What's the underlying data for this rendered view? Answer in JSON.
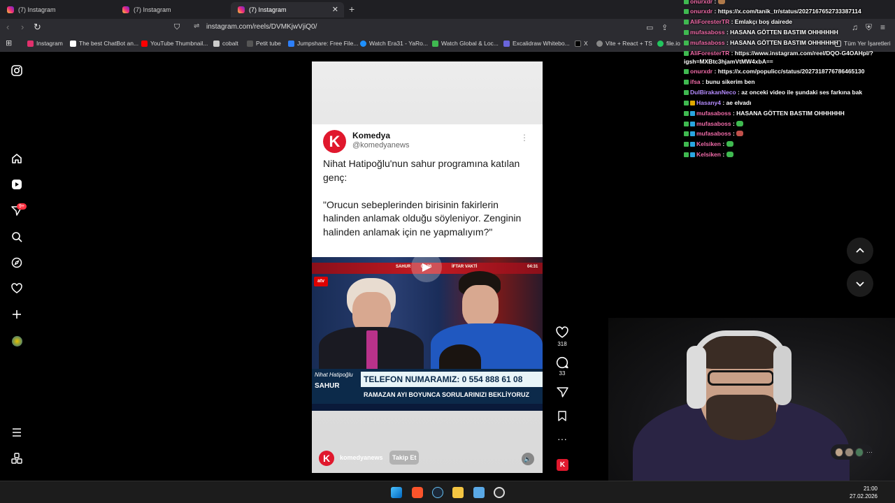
{
  "tabs": [
    {
      "title": "(7) Instagram"
    },
    {
      "title": "(7) Instagram"
    },
    {
      "title": "(7) Instagram"
    }
  ],
  "address": {
    "url": "instagram.com/reels/DVMKjwVjiQ0/"
  },
  "bookmarks": [
    {
      "label": "Instagram",
      "color": "#e1306c"
    },
    {
      "label": "The best ChatBot an...",
      "color": "#ffffff"
    },
    {
      "label": "YouTube Thumbnail...",
      "color": "#ff0000"
    },
    {
      "label": "cobalt",
      "color": "#cccccc"
    },
    {
      "label": "Petit tube",
      "color": "#333333"
    },
    {
      "label": "Jumpshare: Free File...",
      "color": "#2d7ff9"
    },
    {
      "label": "Watch Era31 - YaRo...",
      "color": "#1e90ff"
    },
    {
      "label": "Watch Global & Loc...",
      "color": "#3fb950"
    },
    {
      "label": "Excalidraw Whitebo...",
      "color": "#6965db"
    },
    {
      "label": "X",
      "color": "#000000"
    },
    {
      "label": "Vite + React + TS",
      "color": "#888888"
    },
    {
      "label": "file.io",
      "color": "#22c55e"
    }
  ],
  "bookmarks_all": "Tüm Yer İşaretleri",
  "reel": {
    "tweet_name": "Komedya",
    "tweet_handle": "@komedyanews",
    "tweet_text": "Nihat Hatipoğlu'nun sahur programına katılan genç:\n\n\"Orucun sebeplerinden birisinin fakirlerin halinden anlamak olduğu söyleniyor. Zenginin halinden anlamak için ne yapmalıyım?\"",
    "logo_letter": "K",
    "tv_channel": "atv",
    "band_left": "SAHUR",
    "band_mid": "05:26",
    "band_right": "İFTAR VAKTİ",
    "band_time": "04:31",
    "lower_small": "Nihat Hatipoğlu",
    "lower_big": "SAHUR",
    "phone_line": "TELEFON NUMARAMIZ: 0 554 888 61 08",
    "ramazan_line": "RAMAZAN AYI BOYUNCA SORULARINIZI BEKLİYORUZ",
    "footer_user": "komedyanews",
    "follow_label": "Takip Et",
    "likes": "318",
    "comments": "33"
  },
  "notifications_badge": "9+",
  "chat": [
    {
      "user": "onurxdr",
      "color": "#f06ba8",
      "msg": ""
    },
    {
      "user": "onurxdr",
      "color": "#f06ba8",
      "msg": "https://x.com/tanik_tr/status/2027167652733387114"
    },
    {
      "user": "AliForesterTR",
      "color": "#f06ba8",
      "msg": "Emlakçı boş dairede"
    },
    {
      "user": "mufasaboss",
      "color": "#f06ba8",
      "msg": "HASANA GÖTTEN BASTIM OHHHHHH"
    },
    {
      "user": "mufasaboss",
      "color": "#f06ba8",
      "msg": "HASANA GÖTTEN BASTIM OHHHHHH"
    },
    {
      "user": "AliForesterTR",
      "color": "#f06ba8",
      "msg": "https://www.instagram.com/reel/DQO-G4OAHpl/?"
    },
    {
      "user": "",
      "color": "#ffffff",
      "msg": "igsh=MXBtc3hjamVtMW4xbA=="
    },
    {
      "user": "onurxdr",
      "color": "#f06ba8",
      "msg": "https://x.com/populicc/status/2027318776786465130"
    },
    {
      "user": "ifsa",
      "color": "#f06ba8",
      "msg": "bunu sikerim ben"
    },
    {
      "user": "DulBirakanNeco",
      "color": "#b58cff",
      "msg": "az onceki video ile şundaki ses farkına bak"
    },
    {
      "user": "Hasany4",
      "color": "#b58cff",
      "msg": "ae elvadı"
    },
    {
      "user": "mufasaboss",
      "color": "#f06ba8",
      "msg": "HASANA GÖTTEN BASTIM OHHHHHH"
    },
    {
      "user": "mufasaboss",
      "color": "#f06ba8",
      "msg": ""
    },
    {
      "user": "mufasaboss",
      "color": "#f06ba8",
      "msg": ""
    },
    {
      "user": "Kelsiken",
      "color": "#f06ba8",
      "msg": ""
    },
    {
      "user": "Kelsiken",
      "color": "#f06ba8",
      "msg": ""
    }
  ],
  "clock": {
    "time": "21:00",
    "date": "27.02.2026"
  }
}
